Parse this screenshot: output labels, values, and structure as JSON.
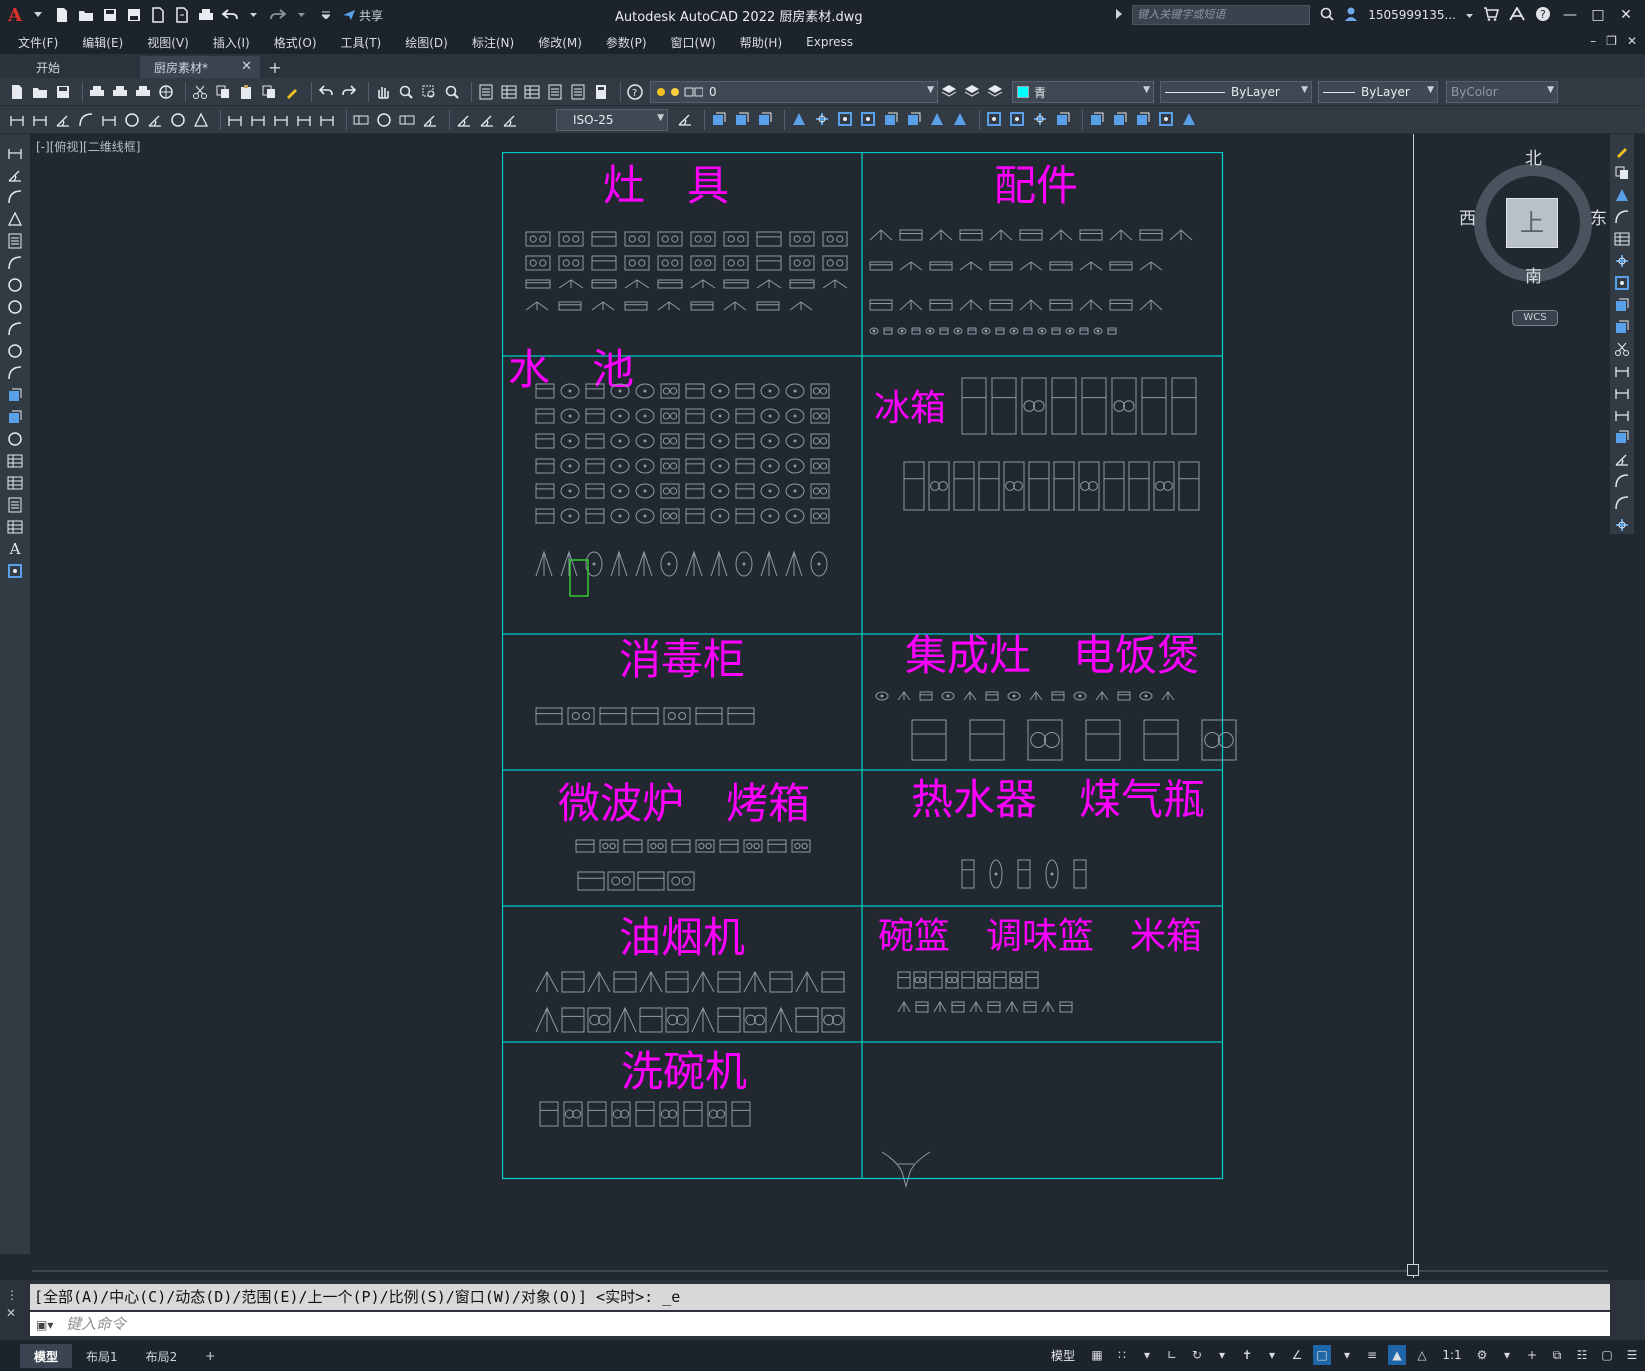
{
  "app": {
    "logo": "A",
    "title": "Autodesk AutoCAD 2022    厨房素材.dwg",
    "share_label": "共享",
    "search_placeholder": "键入关键字或短语",
    "user": "1505999135..."
  },
  "menu": [
    "文件(F)",
    "编辑(E)",
    "视图(V)",
    "插入(I)",
    "格式(O)",
    "工具(T)",
    "绘图(D)",
    "标注(N)",
    "修改(M)",
    "参数(P)",
    "窗口(W)",
    "帮助(H)",
    "Express"
  ],
  "tabs": {
    "start": "开始",
    "active": "厨房素材*",
    "add": "+"
  },
  "toolbar": {
    "layer": "0",
    "color": "青",
    "linetype": "ByLayer",
    "lineweight": "ByLayer",
    "plotstyle": "ByColor",
    "dimstyle": "ISO-25"
  },
  "viewport_label": "[-][俯视][二维线框]",
  "viewcube": {
    "north": "北",
    "south": "南",
    "east": "东",
    "west": "西",
    "face": "上",
    "wcs": "WCS"
  },
  "sections": [
    {
      "title": "灶　具"
    },
    {
      "title": "配件"
    },
    {
      "title": "水　池"
    },
    {
      "title": "冰箱"
    },
    {
      "title": "消毒柜"
    },
    {
      "title": "集成灶　电饭煲"
    },
    {
      "title": "微波炉　烤箱"
    },
    {
      "title": "热水器　煤气瓶"
    },
    {
      "title": "油烟机"
    },
    {
      "title": "碗篮　调味篮　米箱"
    },
    {
      "title": "洗碗机"
    },
    {
      "title": ""
    }
  ],
  "command": {
    "history": "[全部(A)/中心(C)/动态(D)/范围(E)/上一个(P)/比例(S)/窗口(W)/对象(O)] <实时>: _e",
    "placeholder": "键入命令"
  },
  "layout_tabs": [
    "模型",
    "布局1",
    "布局2"
  ],
  "status": {
    "model": "模型",
    "scale": "1:1"
  },
  "colors": {
    "accent": "#1f66a8",
    "section_title": "#ff00ff",
    "grid_line": "#00c8c8",
    "background": "#212830"
  }
}
